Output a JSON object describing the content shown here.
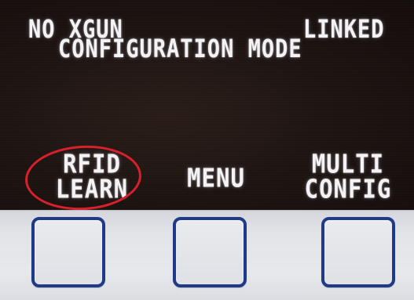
{
  "display": {
    "status_left": "NO XGUN",
    "status_right": "LINKED",
    "title": "CONFIGURATION MODE"
  },
  "softkeys": [
    {
      "label": "RFID\nLEARN"
    },
    {
      "label": "MENU"
    },
    {
      "label": "MULTI\nCONFIG"
    }
  ],
  "colors": {
    "screen_background": "#1e1512",
    "lcd_text": "#f4f2f4",
    "highlight_ring": "#d81f2a",
    "key_border": "#1f3a86",
    "keypad_background": "#e2e4e8"
  }
}
